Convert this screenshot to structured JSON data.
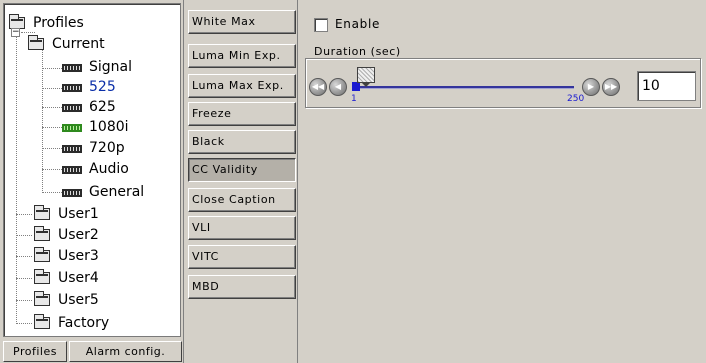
{
  "tree": {
    "root": "Profiles",
    "current": "Current",
    "current_items": [
      "Signal",
      "525",
      "625",
      "1080i",
      "720p",
      "Audio",
      "General"
    ],
    "selected_item": "525",
    "highlighted_item": "1080i",
    "user_profiles": [
      "User1",
      "User2",
      "User3",
      "User4",
      "User5",
      "Factory"
    ],
    "expander_symbol": "−"
  },
  "bottom_tabs": {
    "profiles": "Profiles",
    "alarm_config": "Alarm config."
  },
  "categories": [
    "White Max",
    "Luma Min Exp.",
    "Luma Max Exp.",
    "Freeze",
    "Black",
    "CC Validity",
    "Close Caption",
    "VLI",
    "VITC",
    "MBD"
  ],
  "active_category": "CC Validity",
  "settings": {
    "enable_label": "Enable",
    "enable_checked": false,
    "duration": {
      "legend": "Duration (sec)",
      "min_label": "1",
      "max_label": "250",
      "min": 1,
      "max": 250,
      "value": 10,
      "value_text": "10"
    }
  },
  "icons": {
    "step_first": "◀◀",
    "step_prev": "◀",
    "step_next": "▶",
    "step_last": "▶▶"
  },
  "colors": {
    "panel_bg": "#d4d0c8",
    "tree_bg": "#ffffff",
    "selected_text": "#0a2ea8",
    "slider_blue": "#1a1ad0"
  }
}
